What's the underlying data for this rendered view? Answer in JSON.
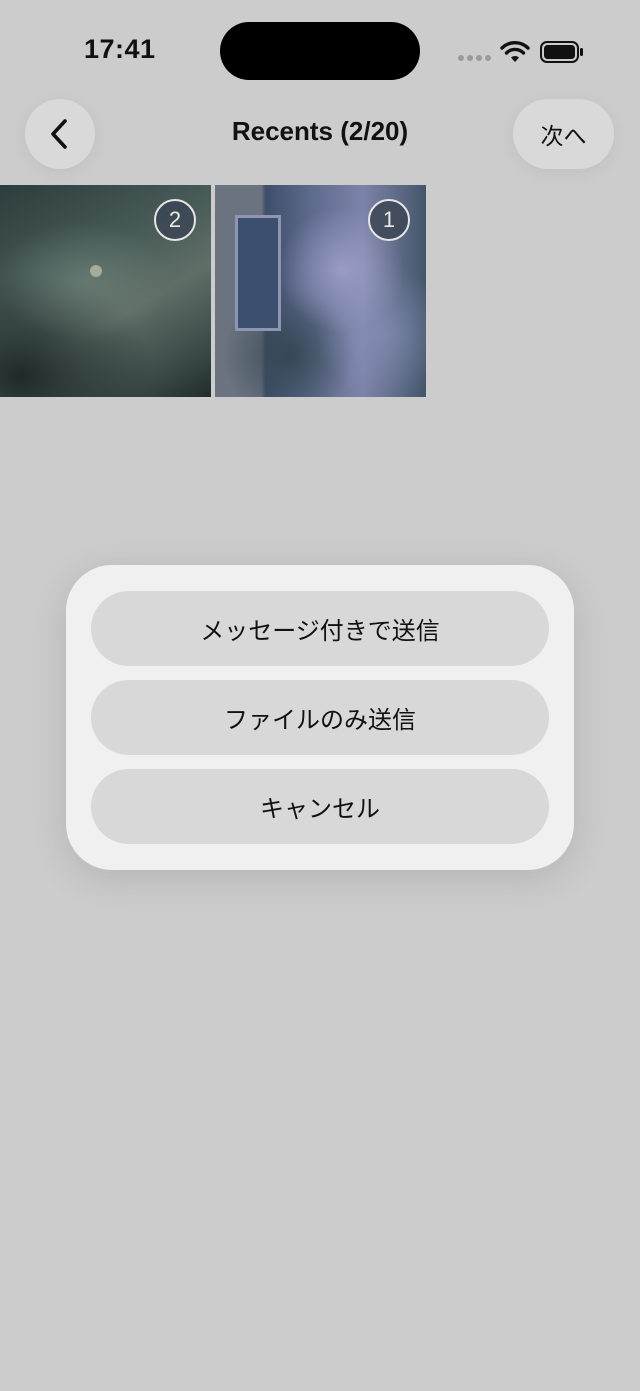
{
  "status_bar": {
    "time": "17:41",
    "icons": [
      "signal-dots-icon",
      "wifi-icon",
      "battery-icon"
    ]
  },
  "nav": {
    "back_icon": "chevron-left-icon",
    "title": "Recents (2/20)",
    "next_label": "次へ"
  },
  "photos": [
    {
      "badge": "2",
      "description_icon": "photo-thumbnail"
    },
    {
      "badge": "1",
      "description_icon": "photo-thumbnail"
    }
  ],
  "action_sheet": {
    "send_with_message": "メッセージ付きで送信",
    "send_file_only": "ファイルのみ送信",
    "cancel": "キャンセル"
  },
  "colors": {
    "background": "#cccccc",
    "sheet": "#f0f0f0",
    "sheet_button": "#d8d8d8",
    "nav_button": "#d9d9d9"
  }
}
